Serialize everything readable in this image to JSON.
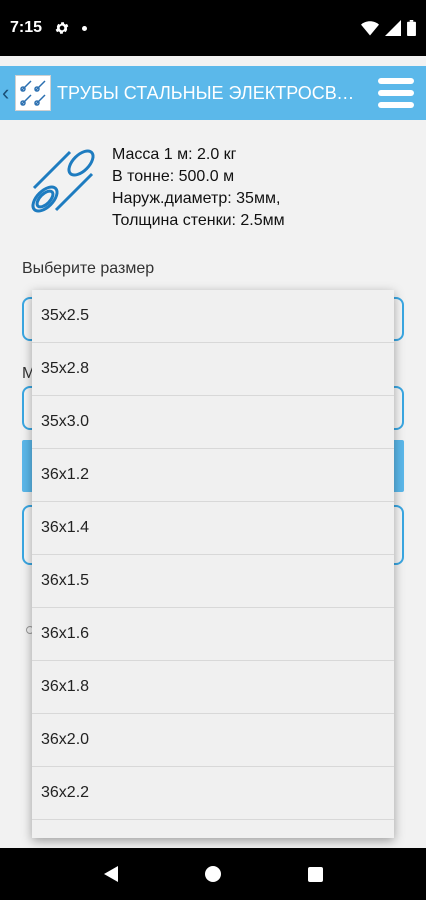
{
  "status_bar": {
    "time": "7:15",
    "icons": [
      "gear-icon",
      "notification-dot-icon",
      "wifi-icon",
      "cell-signal-icon",
      "battery-icon"
    ]
  },
  "app_bar": {
    "title": "ТРУБЫ СТАЛЬНЫЕ ЭЛЕКТРОСВАР...",
    "back_icon": "chevron-left-icon",
    "menu_icon": "hamburger-menu-icon",
    "color": "#5bb8ea"
  },
  "info": {
    "mass": "Масса 1 м: 2.0 кг",
    "per_ton": "В тонне: 500.0 м",
    "diameter": "Наруж.диаметр: 35мм,",
    "wall": "Толщина стенки: 2.5мм"
  },
  "form": {
    "select_label": "Выберите размер",
    "partial_label": "М"
  },
  "dropdown": {
    "options": [
      "35x2.5",
      "35x2.8",
      "35x3.0",
      "36x1.2",
      "36x1.4",
      "36x1.5",
      "36x1.6",
      "36x1.8",
      "36x2.0",
      "36x2.2",
      ""
    ]
  },
  "nav_bar": {
    "icons": [
      "back-triangle-icon",
      "home-circle-icon",
      "recents-square-icon"
    ]
  }
}
